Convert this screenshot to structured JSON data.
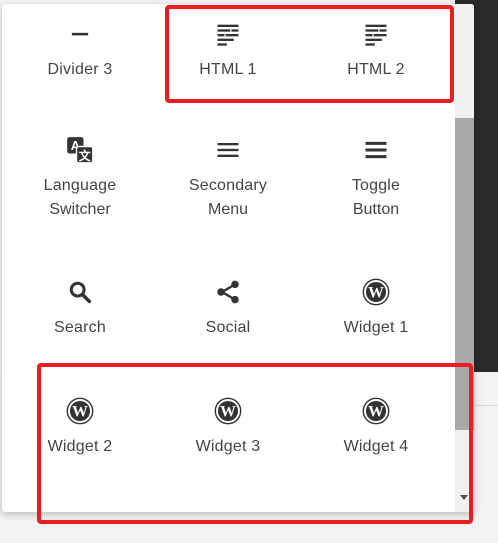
{
  "items": [
    {
      "label": "Divider 3",
      "icon": "divider-icon"
    },
    {
      "label": "HTML 1",
      "icon": "html-icon"
    },
    {
      "label": "HTML 2",
      "icon": "html-icon"
    },
    {
      "label": "Language Switcher",
      "label_line1": "Language",
      "label_line2": "Switcher",
      "icon": "translate-icon"
    },
    {
      "label": "Secondary Menu",
      "label_line1": "Secondary",
      "label_line2": "Menu",
      "icon": "menu-icon"
    },
    {
      "label": "Toggle Button",
      "label_line1": "Toggle",
      "label_line2": "Button",
      "icon": "menu-icon"
    },
    {
      "label": "Search",
      "icon": "search-icon"
    },
    {
      "label": "Social",
      "icon": "share-icon"
    },
    {
      "label": "Widget 1",
      "icon": "wordpress-icon"
    },
    {
      "label": "Widget 2",
      "icon": "wordpress-icon"
    },
    {
      "label": "Widget 3",
      "icon": "wordpress-icon"
    },
    {
      "label": "Widget 4",
      "icon": "wordpress-icon"
    }
  ],
  "colors": {
    "highlight": "#ee1c1c",
    "icon": "#333333",
    "text": "#444444"
  }
}
